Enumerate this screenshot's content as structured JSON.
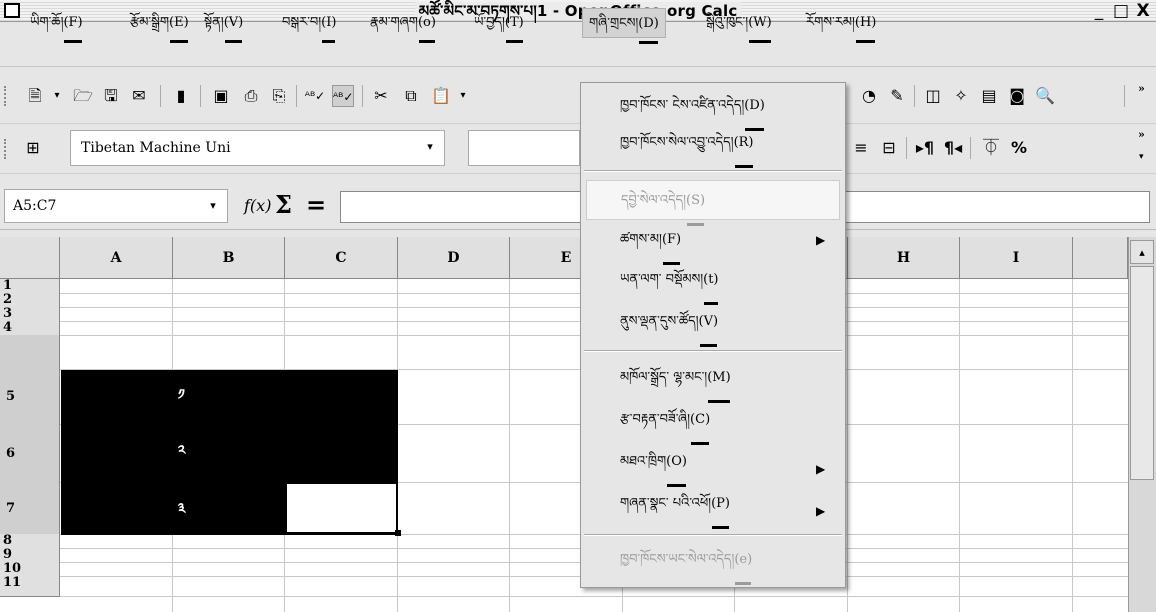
{
  "window": {
    "title": "མཚོ་མིང་མ་བཏགས་པ།1 - OpenOffice.org Calc",
    "minimize": "_",
    "maximize": "□",
    "close": "X"
  },
  "menubar": [
    {
      "label": "ཡིག་ཆོ།",
      "key": "(F)"
    },
    {
      "label": "རྩོམ་སྒྲིག",
      "key": "(E)"
    },
    {
      "label": "སྟོན།",
      "key": "(V)"
    },
    {
      "label": "བསྒར་བ།",
      "key": "(I)"
    },
    {
      "label": "རྣམ་གཞག",
      "key": "(o)"
    },
    {
      "label": "ཡོ་བྱད།",
      "key": "(T)"
    },
    {
      "label": "གཞི་གྲངས།",
      "key": "(D)"
    },
    {
      "label": "སྒེའུ་ཁུང་།",
      "key": "(W)"
    },
    {
      "label": "རོགས་རམ།",
      "key": "(H)"
    }
  ],
  "toolbar1": {
    "icons": [
      "new-icon",
      "open-icon",
      "save-icon",
      "email-icon",
      "edit-file-icon",
      "export-pdf-icon",
      "print-icon",
      "print-preview-icon",
      "spellcheck-icon",
      "autospell-icon",
      "cut-icon",
      "copy-icon",
      "paste-icon",
      "chart-icon",
      "draw-icon",
      "navigator-icon",
      "gallery-icon",
      "datasources-icon",
      "zoom-icon"
    ],
    "more": "»"
  },
  "toolbar2": {
    "font_name": "Tibetan Machine Uni",
    "more": "»"
  },
  "formulabar": {
    "name_box": "A5:C7",
    "fx": "f(x)",
    "sum": "Σ",
    "equals": "=",
    "input": ""
  },
  "columns": [
    "A",
    "B",
    "C",
    "D",
    "E",
    "F",
    "G",
    "H",
    "I"
  ],
  "rows": [
    "1",
    "2",
    "3",
    "4",
    "5",
    "6",
    "7",
    "8",
    "9",
    "10",
    "11"
  ],
  "cells": {
    "B5": "༡",
    "B6": "༢",
    "B7": "༣"
  },
  "selection": "A5:C7",
  "data_menu": {
    "items": [
      {
        "label": "ཁྱབ་ཁོངས་ ངེས་འཛིན་འདེད།",
        "key": "(D)",
        "enabled": true
      },
      {
        "label": "ཁྱབ་ཁོངས་སེལ་འབྱུ་འདེད།",
        "key": "(R)",
        "enabled": true
      },
      {
        "label": "དབྱེ་སེལ་འདེད།",
        "key": "(S)",
        "enabled": false
      },
      {
        "label": "ཚགས་མ།",
        "key": "(F)",
        "enabled": true,
        "submenu": true
      },
      {
        "label": "ཡན་ལག་ བསྡོམས།",
        "key": "(t)",
        "enabled": true
      },
      {
        "label": "ནུས་ལྡན་དུས་ཚོད།",
        "key": "(V)",
        "enabled": true
      },
      {
        "label": "མཁོལ་སྒྲོད་ ལྷ་མང་།",
        "key": "(M)",
        "enabled": true
      },
      {
        "label": "རྩ་བརྟན་བཟོ་ཞི།",
        "key": "(C)",
        "enabled": true
      },
      {
        "label": "མཐའ་ཁྲིག",
        "key": "(O)",
        "enabled": true,
        "submenu": true
      },
      {
        "label": "གཞན་སྣང་ པའི་འཕོ།",
        "key": "(P)",
        "enabled": true,
        "submenu": true
      },
      {
        "label": "ཁྱབ་ཁོངས་ཡང་སེལ་འདེད།",
        "key": "(e)",
        "enabled": false
      }
    ]
  }
}
